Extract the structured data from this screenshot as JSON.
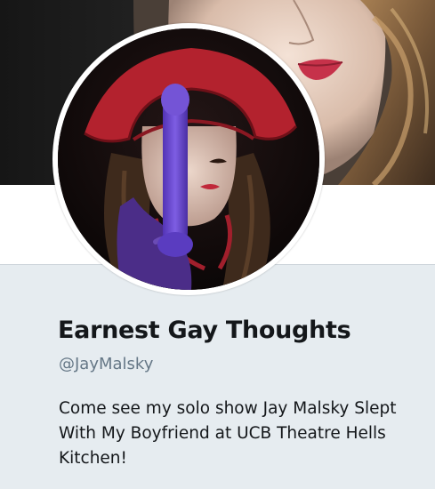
{
  "profile": {
    "display_name": "Earnest Gay Thoughts",
    "handle": "@JayMalsky",
    "bio": "Come see my solo show Jay Malsky Slept With My Boyfriend at UCB Theatre Hells Kitchen!"
  },
  "colors": {
    "page_background": "#e6ecf0",
    "name_text": "#14171a",
    "handle_text": "#657786"
  }
}
